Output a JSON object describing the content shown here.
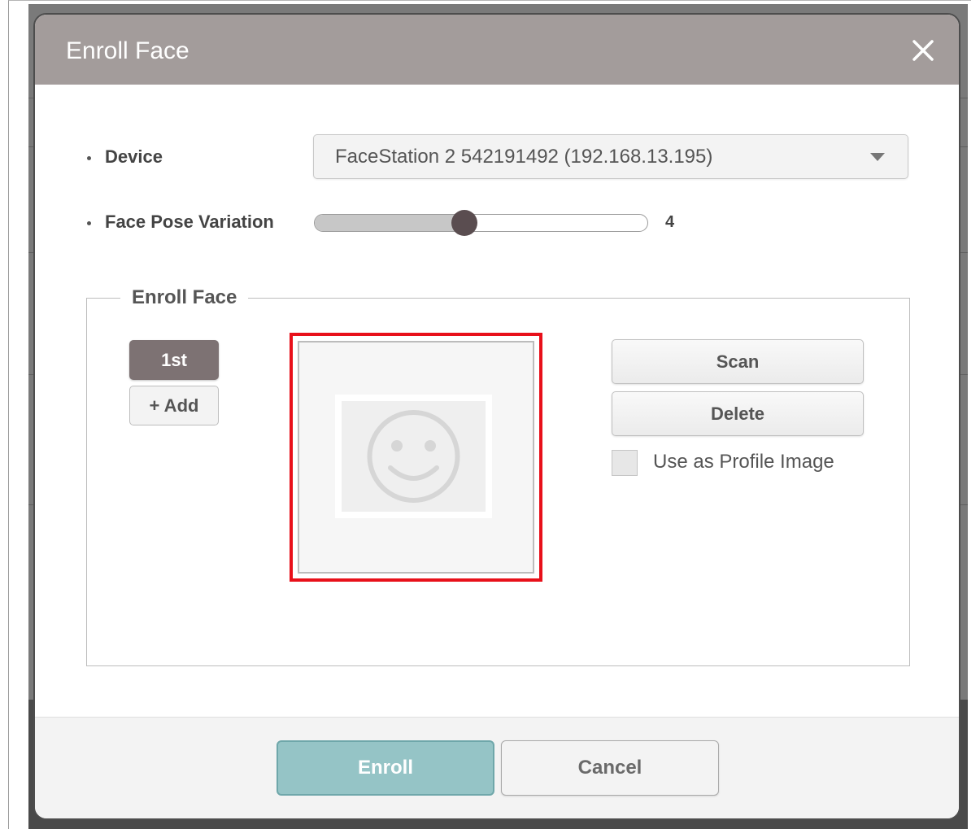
{
  "dialog": {
    "title": "Enroll Face"
  },
  "device": {
    "label": "Device",
    "selected": "FaceStation 2 542191492 (192.168.13.195)"
  },
  "pose": {
    "label": "Face Pose Variation",
    "value": "4",
    "fraction": 0.45
  },
  "enroll_section": {
    "legend": "Enroll Face",
    "slots": [
      "1st"
    ],
    "add_label": "+ Add",
    "scan_label": "Scan",
    "delete_label": "Delete",
    "profile_checkbox_label": "Use as Profile Image",
    "profile_checked": false
  },
  "footer": {
    "enroll_label": "Enroll",
    "cancel_label": "Cancel"
  },
  "colors": {
    "header": "#a39c9b",
    "highlight_border": "#e8101a",
    "enroll_button": "#95c4c6",
    "slot_active": "#7d7273"
  },
  "icons": {
    "close": "close-icon",
    "dropdown": "chevron-down-icon",
    "face_placeholder": "smiley-face-icon"
  }
}
